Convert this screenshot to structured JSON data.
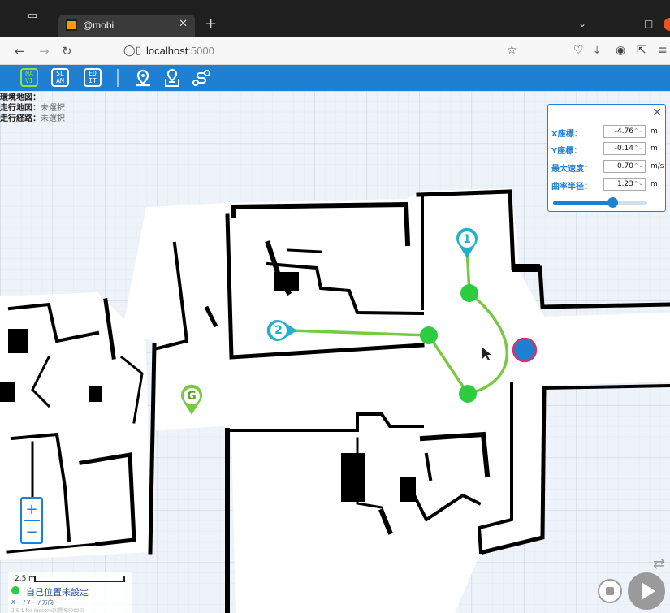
{
  "browser": {
    "tab_title": "@mobi",
    "url_host": "localhost",
    "url_port": ":5000"
  },
  "toolbar": {
    "modes": [
      {
        "top": "NA",
        "bottom": "VI",
        "active": true
      },
      {
        "top": "SL",
        "bottom": "AM",
        "active": false
      },
      {
        "top": "ED",
        "bottom": "IT",
        "active": false
      }
    ],
    "tools": [
      "location-pin-icon",
      "map-pin-icon",
      "route-icon"
    ]
  },
  "info": {
    "env_map_label": "環境地図：",
    "env_map_value": "",
    "run_map_label": "走行地図：",
    "run_map_value": "未選択",
    "run_route_label": "走行経路：",
    "run_route_value": "未選択"
  },
  "panel": {
    "rows": [
      {
        "label": "X座標：",
        "value": "-4.76",
        "unit": "m"
      },
      {
        "label": "Y座標：",
        "value": "-0.14",
        "unit": "m"
      },
      {
        "label": "最大速度：",
        "value": "0.70",
        "unit": "m/s"
      },
      {
        "label": "曲率半径：",
        "value": "1.23",
        "unit": "m"
      }
    ],
    "slider_fraction": 0.63
  },
  "markers": {
    "waypoint_1": "1",
    "waypoint_2": "2",
    "goal": "G"
  },
  "status": {
    "scale_label": "2.5 m",
    "position_text": "自己位置未設定",
    "coord_text": "X ---/ Y ---/ 方向 ---",
    "hint_text": "2.5-1 for mocoro(?)開発(0000)"
  },
  "colors": {
    "accent": "#1e7fd3",
    "active_mode": "#8fe23a",
    "waypoint": "#20b2c8",
    "goal": "#7ac943",
    "path_node": "#2ecc40",
    "robot": "#1e7fd3",
    "robot_border": "#d6336c"
  }
}
